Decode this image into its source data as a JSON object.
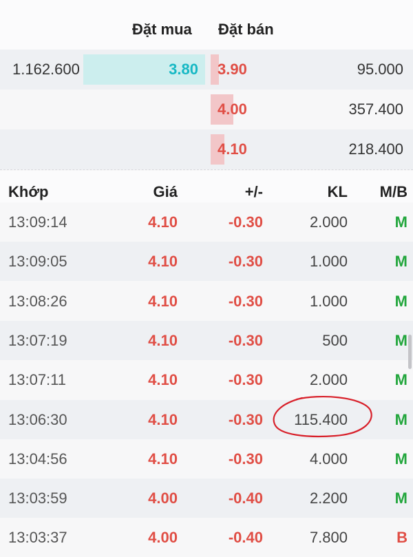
{
  "order_book": {
    "headers": {
      "buy": "Đặt mua",
      "sell": "Đặt bán"
    },
    "rows": [
      {
        "bid_volume": "1.162.600",
        "bid_price": "3.80",
        "ask_price": "3.90",
        "ask_volume": "95.000",
        "bid_fill": 1.0,
        "ask_fill": 0.08
      },
      {
        "bid_volume": "",
        "bid_price": "",
        "ask_price": "4.00",
        "ask_volume": "357.400",
        "bid_fill": 0,
        "ask_fill": 0.3
      },
      {
        "bid_volume": "",
        "bid_price": "",
        "ask_price": "4.10",
        "ask_volume": "218.400",
        "bid_fill": 0,
        "ask_fill": 0.18
      }
    ],
    "colors": {
      "bid": "#16b8c4",
      "ask": "#e04e45",
      "bid_bar": "#cceeee",
      "ask_bar": "#f2c6c8"
    }
  },
  "trades": {
    "headers": {
      "time": "Khớp",
      "price": "Giá",
      "change": "+/-",
      "volume": "KL",
      "side": "M/B"
    },
    "rows": [
      {
        "time": "13:09:14",
        "price": "4.10",
        "change": "-0.30",
        "volume": "2.000",
        "side": "M"
      },
      {
        "time": "13:09:05",
        "price": "4.10",
        "change": "-0.30",
        "volume": "1.000",
        "side": "M"
      },
      {
        "time": "13:08:26",
        "price": "4.10",
        "change": "-0.30",
        "volume": "1.000",
        "side": "M"
      },
      {
        "time": "13:07:19",
        "price": "4.10",
        "change": "-0.30",
        "volume": "500",
        "side": "M"
      },
      {
        "time": "13:07:11",
        "price": "4.10",
        "change": "-0.30",
        "volume": "2.000",
        "side": "M"
      },
      {
        "time": "13:06:30",
        "price": "4.10",
        "change": "-0.30",
        "volume": "115.400",
        "side": "M"
      },
      {
        "time": "13:04:56",
        "price": "4.10",
        "change": "-0.30",
        "volume": "4.000",
        "side": "M"
      },
      {
        "time": "13:03:59",
        "price": "4.00",
        "change": "-0.40",
        "volume": "2.200",
        "side": "M"
      },
      {
        "time": "13:03:37",
        "price": "4.00",
        "change": "-0.40",
        "volume": "7.800",
        "side": "B"
      }
    ],
    "colors": {
      "buy_side": "#22a63c",
      "sell_side": "#e04e45",
      "negative": "#e04e45"
    }
  }
}
